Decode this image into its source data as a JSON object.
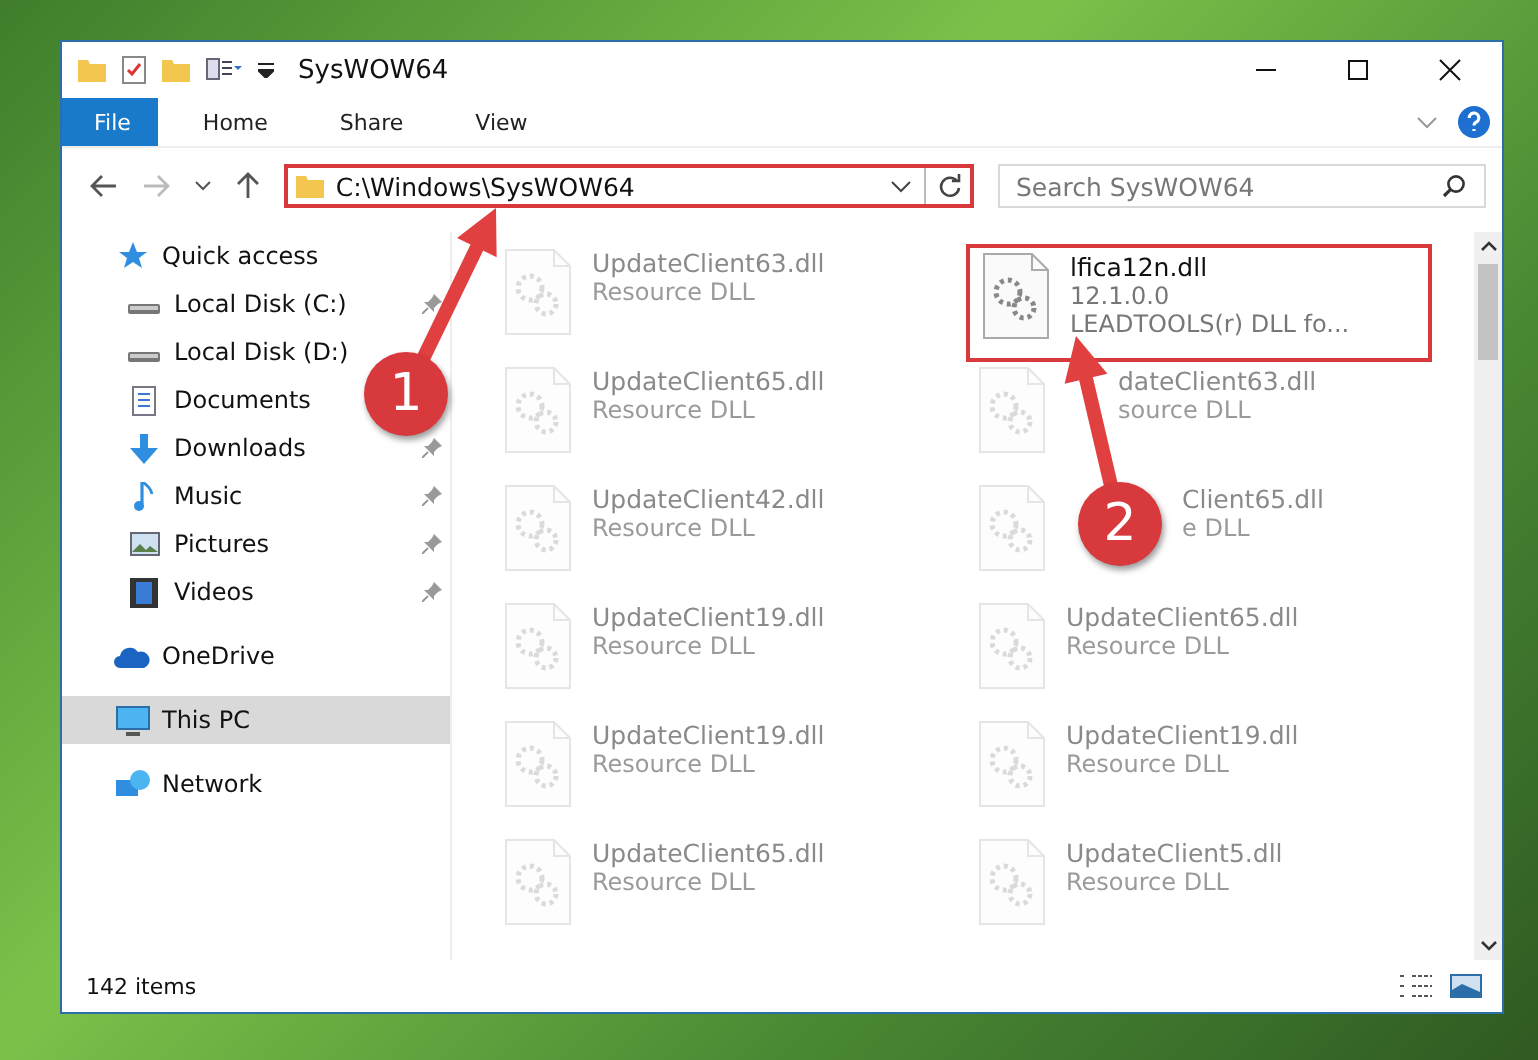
{
  "window": {
    "title": "SysWOW64"
  },
  "ribbon_tabs": [
    {
      "label": "File",
      "selected": true
    },
    {
      "label": "Home",
      "selected": false
    },
    {
      "label": "Share",
      "selected": false
    },
    {
      "label": "View",
      "selected": false
    }
  ],
  "address": {
    "path": "C:\\Windows\\SysWOW64",
    "highlighted": true
  },
  "search": {
    "placeholder": "Search SysWOW64"
  },
  "sidebar": {
    "items": [
      {
        "label": "Quick access",
        "kind": "star",
        "selected": false,
        "children": [
          {
            "label": "Local Disk (C:)",
            "kind": "drive",
            "pinned": true,
            "selected": false
          },
          {
            "label": "Local Disk (D:)",
            "kind": "drive",
            "pinned": false,
            "selected": false
          },
          {
            "label": "Documents",
            "kind": "document",
            "pinned": false,
            "selected": false
          },
          {
            "label": "Downloads",
            "kind": "download",
            "pinned": true,
            "selected": false
          },
          {
            "label": "Music",
            "kind": "music",
            "pinned": true,
            "selected": false
          },
          {
            "label": "Pictures",
            "kind": "picture",
            "pinned": true,
            "selected": false
          },
          {
            "label": "Videos",
            "kind": "video",
            "pinned": true,
            "selected": false
          }
        ]
      },
      {
        "label": "OneDrive",
        "kind": "cloud",
        "selected": false
      },
      {
        "label": "This PC",
        "kind": "monitor",
        "selected": true
      },
      {
        "label": "Network",
        "kind": "network",
        "selected": false
      }
    ]
  },
  "files": [
    {
      "name": "UpdateClient63.dll",
      "details": [
        "Resource DLL"
      ],
      "highlighted": false,
      "kind": "plain"
    },
    {
      "name": "lfica12n.dll",
      "details": [
        "12.1.0.0",
        "LEADTOOLS(r) DLL fo..."
      ],
      "highlighted": true,
      "kind": "plain"
    },
    {
      "name": "UpdateClient65.dll",
      "details": [
        "Resource DLL"
      ],
      "highlighted": false,
      "kind": "plain"
    },
    {
      "name": "dateClient63.dll",
      "details": [
        "source DLL"
      ],
      "highlighted": false,
      "kind": "behind_arrow"
    },
    {
      "name": "UpdateClient42.dll",
      "details": [
        "Resource DLL"
      ],
      "highlighted": false,
      "kind": "plain"
    },
    {
      "name": "Client65.dll",
      "details": [
        "e DLL"
      ],
      "highlighted": false,
      "kind": "behind_badge"
    },
    {
      "name": "UpdateClient19.dll",
      "details": [
        "Resource DLL"
      ],
      "highlighted": false,
      "kind": "plain"
    },
    {
      "name": "UpdateClient65.dll",
      "details": [
        "Resource DLL"
      ],
      "highlighted": false,
      "kind": "plain"
    },
    {
      "name": "UpdateClient19.dll",
      "details": [
        "Resource DLL"
      ],
      "highlighted": false,
      "kind": "plain"
    },
    {
      "name": "UpdateClient19.dll",
      "details": [
        "Resource DLL"
      ],
      "highlighted": false,
      "kind": "plain"
    },
    {
      "name": "UpdateClient65.dll",
      "details": [
        "Resource DLL"
      ],
      "highlighted": false,
      "kind": "plain"
    },
    {
      "name": "UpdateClient5.dll",
      "details": [
        "Resource DLL"
      ],
      "highlighted": false,
      "kind": "plain"
    }
  ],
  "status_bar": {
    "item_count": "142 items"
  },
  "annotations": [
    {
      "label": "1"
    },
    {
      "label": "2"
    }
  ]
}
